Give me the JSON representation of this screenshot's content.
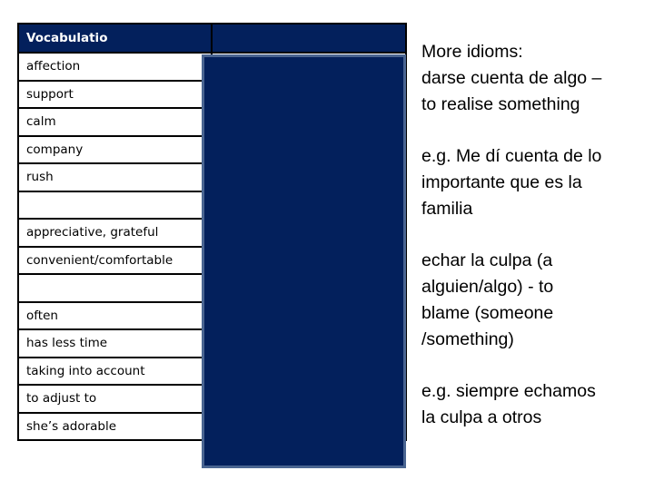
{
  "table": {
    "header": [
      "Vocabulatio",
      ""
    ],
    "rows": [
      {
        "english": "affection",
        "spanish": ""
      },
      {
        "english": "support",
        "spanish": ""
      },
      {
        "english": "calm",
        "spanish": ""
      },
      {
        "english": "company",
        "spanish": ""
      },
      {
        "english": "rush",
        "spanish": ""
      },
      {
        "english": "",
        "spanish": ""
      },
      {
        "english": "appreciative, grateful",
        "spanish": ""
      },
      {
        "english": "convenient/comfortable",
        "spanish": ""
      },
      {
        "english": "",
        "spanish": ""
      },
      {
        "english": "often",
        "spanish": ""
      },
      {
        "english": "has less time",
        "spanish": ""
      },
      {
        "english": "taking into account",
        "spanish": ""
      },
      {
        "english": "to adjust to",
        "spanish": ""
      },
      {
        "english": "she’s adorable",
        "spanish": ""
      }
    ]
  },
  "idioms": {
    "blocks": [
      {
        "lines": [
          "More idioms:",
          "darse cuenta de algo –",
          "to realise something"
        ]
      },
      {
        "lines": [
          "e.g. Me dí cuenta de lo",
          "importante que es la",
          "familia"
        ]
      },
      {
        "lines": [
          "echar la culpa (a",
          "alguien/algo)  - to",
          "blame (someone",
          "/something)"
        ]
      },
      {
        "lines": [
          "e.g. siempre echamos",
          "la culpa a otros"
        ]
      }
    ]
  },
  "colors": {
    "header_bg": "#03205c",
    "cover_bg": "#03205c",
    "cover_border": "#4a6591"
  }
}
